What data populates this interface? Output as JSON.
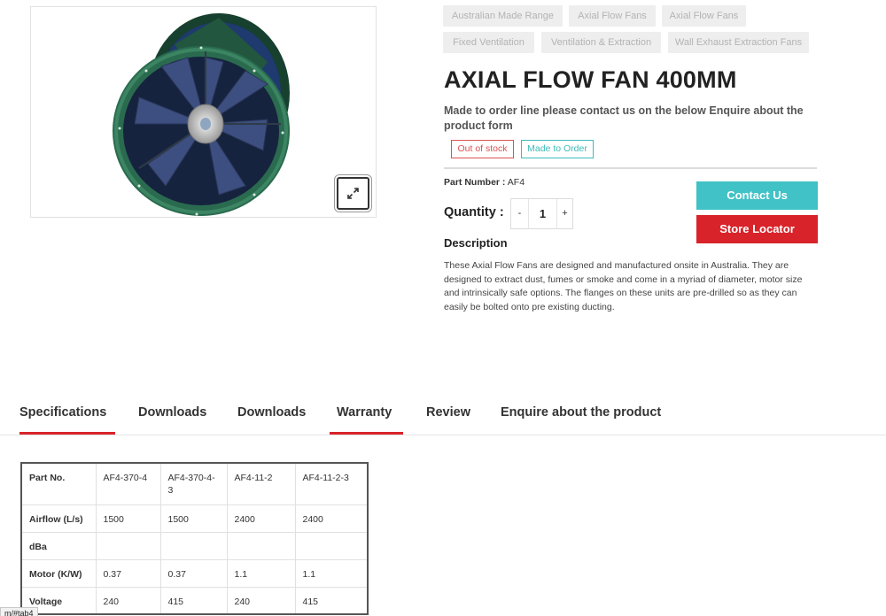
{
  "categories": [
    "Australian Made Range",
    "Axial Flow Fans",
    "Axial Flow Fans",
    "Fixed Ventilation",
    "Ventilation & Extraction",
    "Wall Exhaust Extraction Fans"
  ],
  "product": {
    "title": "AXIAL FLOW FAN 400MM",
    "subtitle": "Made to order line please contact us on the below Enquire about the product form",
    "badges": [
      "Out of stock",
      "Made to Order"
    ],
    "part_label": "Part Number :",
    "part_value": "AF4",
    "quantity_label": "Quantity :",
    "quantity_value": "1",
    "minus": "-",
    "plus": "+",
    "contact_label": "Contact Us",
    "store_label": "Store Locator",
    "description_heading": "Description",
    "description": "These Axial Flow Fans are designed and manufactured onsite in Australia. They are designed to extract dust, fumes or smoke and come in a myriad of diameter, motor size and intrinsically safe options. The flanges on these units are pre-drilled so as they can easily be bolted onto pre existing ducting."
  },
  "tabs": [
    "Specifications",
    "Downloads",
    "Downloads",
    "Warranty",
    "Review",
    "Enquire about the product"
  ],
  "spec_table": {
    "headers": [
      "Part No.",
      "AF4-370-4",
      "AF4-370-4-3",
      "AF4-11-2",
      "AF4-11-2-3"
    ],
    "rows": [
      [
        "Airflow (L/s)",
        "1500",
        "1500",
        "2400",
        "2400"
      ],
      [
        "dBa",
        "",
        "",
        "",
        ""
      ],
      [
        "Motor (K/W)",
        "0.37",
        "0.37",
        "1.1",
        "1.1"
      ],
      [
        "Voltage",
        "240",
        "415",
        "240",
        "415"
      ]
    ]
  },
  "status_url": "m/#tab4",
  "colors": {
    "teal": "#41c2c6",
    "red": "#d8232a",
    "tab_underline": "#d8232a"
  },
  "icons": {
    "zoom": "expand-arrows-icon"
  }
}
